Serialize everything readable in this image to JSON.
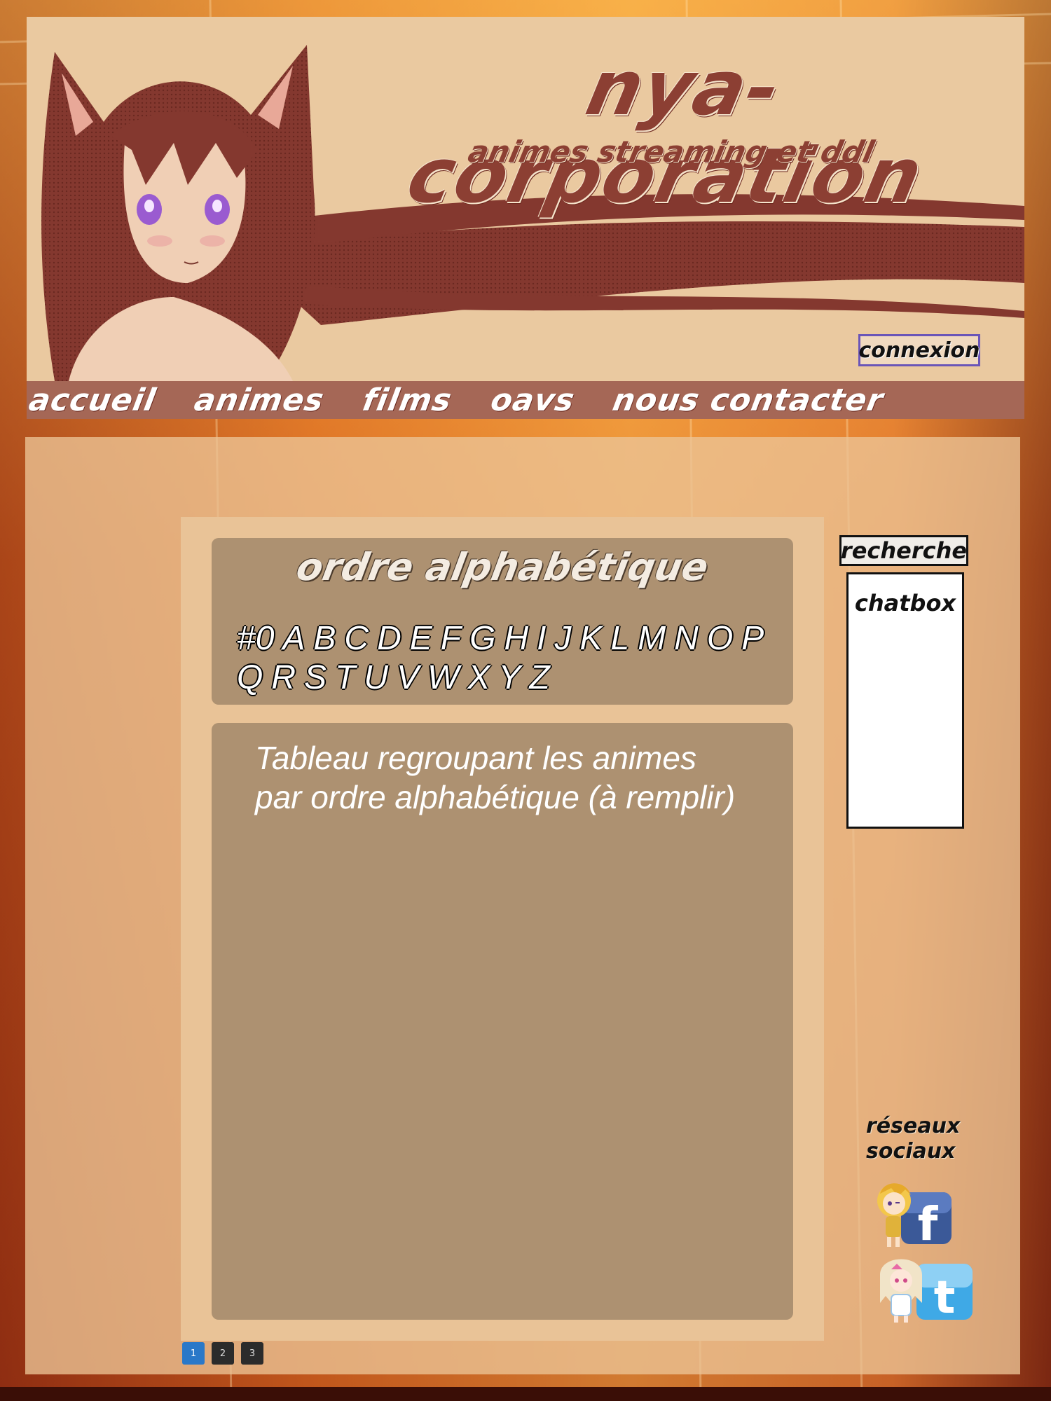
{
  "header": {
    "title": "nya-corporation",
    "subtitle": "animes streaming et ddl",
    "login_label": "connexion"
  },
  "nav": {
    "items": [
      {
        "label": "accueil"
      },
      {
        "label": "animes"
      },
      {
        "label": "films"
      },
      {
        "label": "oavs"
      },
      {
        "label": "nous contacter"
      }
    ]
  },
  "alphabet_section": {
    "title": "ordre alphabétique",
    "letters": [
      "#0",
      "A",
      "B",
      "C",
      "D",
      "E",
      "F",
      "G",
      "H",
      "I",
      "J",
      "K",
      "L",
      "M",
      "N",
      "O",
      "P",
      "Q",
      "R",
      "S",
      "T",
      "U",
      "V",
      "W",
      "X",
      "Y",
      "Z"
    ]
  },
  "table_section": {
    "text_line1": "Tableau regroupant les animes",
    "text_line2": "par ordre alphabétique (à remplir)"
  },
  "pagination": {
    "pages": [
      "1",
      "2",
      "3"
    ],
    "current": "1"
  },
  "sidebar": {
    "search_label": "recherche",
    "chatbox_title": "chatbox",
    "social_title_line1": "réseaux",
    "social_title_line2": "sociaux",
    "social_links": [
      {
        "icon": "facebook-icon"
      },
      {
        "icon": "twitter-icon"
      }
    ]
  },
  "colors": {
    "header_bg": "#eac9a0",
    "nav_bg": "#a56756",
    "title_color": "#8c3f33",
    "content_box": "#ad9171",
    "page_active": "#2a78c8"
  }
}
